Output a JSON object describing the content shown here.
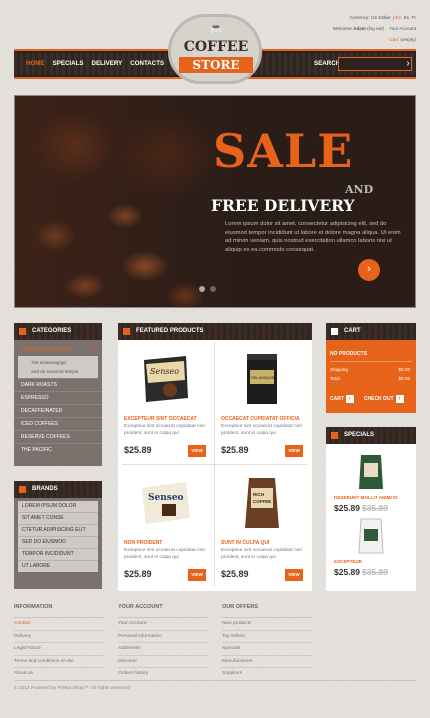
{
  "header": {
    "currency_label": "Currency:",
    "currency_value": "US Dollar",
    "languages": [
      "En",
      "Es",
      "Fr"
    ],
    "welcome": "Welcome",
    "user": "Adam",
    "logout": "(log out)",
    "account": "Your Account",
    "cart_label": "Cart:",
    "cart_value": "(empty)"
  },
  "logo": {
    "line1": "COFFEE",
    "line2": "STORE"
  },
  "nav": {
    "items": [
      "HOME",
      "SPECIALS",
      "DELIVERY",
      "CONTACTS"
    ],
    "search_label": "SEARCH",
    "search_placeholder": ""
  },
  "hero": {
    "title": "SALE",
    "and": "AND",
    "subtitle": "FREE DELIVERY",
    "text": "Lorem ipsum dolor sit amet, consectetur adipisicing elit, sed do eiusmod tempor incididunt ut labore et dolore magna aliqua. Ut enim ad minim veniam, quis nostrud exercitation ullamco laboris nisi ut aliquip ex ea commodo consequat."
  },
  "categories": {
    "title": "CATEGORIES",
    "selected": "SIGNATURE BLENDS",
    "sub": [
      "Tint enimenagrgd",
      "Sed do eiusmod tempor"
    ],
    "items": [
      "DARK ROASTS",
      "ESPRESSO",
      "DECAFFEINATED",
      "ICED COFFEES",
      "RESERVE COFFEES",
      "THE PACIFIC"
    ]
  },
  "brands": {
    "title": "BRANDS",
    "items": [
      "LOREM IPSUM DOLOR",
      "SIT AMET CONSE",
      "CTETUR ADIPISICING ELIT",
      "SED DO EIUSMOD",
      "TEMPOR INCIDIDUNT",
      "UT LABORE"
    ]
  },
  "featured": {
    "title": "FEATURED PRODUCTS",
    "products": [
      {
        "name": "EXCEPTEUR SINT OCCAECAT",
        "desc": "Excepteur sint occaecat cupidatat non proident, sunt in culpa qui",
        "price": "$25.89",
        "btn": "VIEW"
      },
      {
        "name": "OCCAECAT CUPIDATAT OFFICIA",
        "desc": "Excepteur sint occaecat cupidatat non proident, sunt in culpa qui",
        "price": "$25.89",
        "btn": "VIEW"
      },
      {
        "name": "NON PROIDENT",
        "desc": "Excepteur sint occaecat cupidatat non proident, sunt in culpa qui",
        "price": "$25.89",
        "btn": "VIEW"
      },
      {
        "name": "SUNT IN CULPA QUI",
        "desc": "Excepteur sint occaecat cupidatat non proident, sunt in culpa qui",
        "price": "$25.89",
        "btn": "VIEW"
      }
    ]
  },
  "cart": {
    "title": "CART",
    "no_products": "NO PRODUCTS",
    "shipping_label": "Shipping",
    "shipping_value": "$0.00",
    "total_label": "Total",
    "total_value": "$0.00",
    "cart_btn": "CART",
    "checkout_btn": "CHECK OUT"
  },
  "specials": {
    "title": "SPECIALS",
    "items": [
      {
        "name": "DESERUNT MOLLIT ANIMI ID",
        "price": "$25.89",
        "old": "$35.89"
      },
      {
        "name": "EXCEPTEUR",
        "price": "$25.89",
        "old": "$35.89"
      }
    ]
  },
  "footer": {
    "columns": [
      {
        "title": "INFORMATION",
        "items": [
          "Contact",
          "Delivery",
          "Legal Notice",
          "Terms and conditions of use",
          "About us"
        ]
      },
      {
        "title": "YOUR ACCOUNT",
        "items": [
          "Your Account",
          "Personal information",
          "Addresses",
          "Discount",
          "Orders history"
        ]
      },
      {
        "title": "OUR OFFERS",
        "items": [
          "New products",
          "Top sellers",
          "Specials",
          "Manufacturers",
          "Suppliers"
        ]
      }
    ],
    "copyright": "© 2012 Powered by Presta Shop™. All rights reserved"
  },
  "colors": {
    "accent": "#e8631a",
    "dark": "#2b2220",
    "panel": "#7b726d"
  }
}
